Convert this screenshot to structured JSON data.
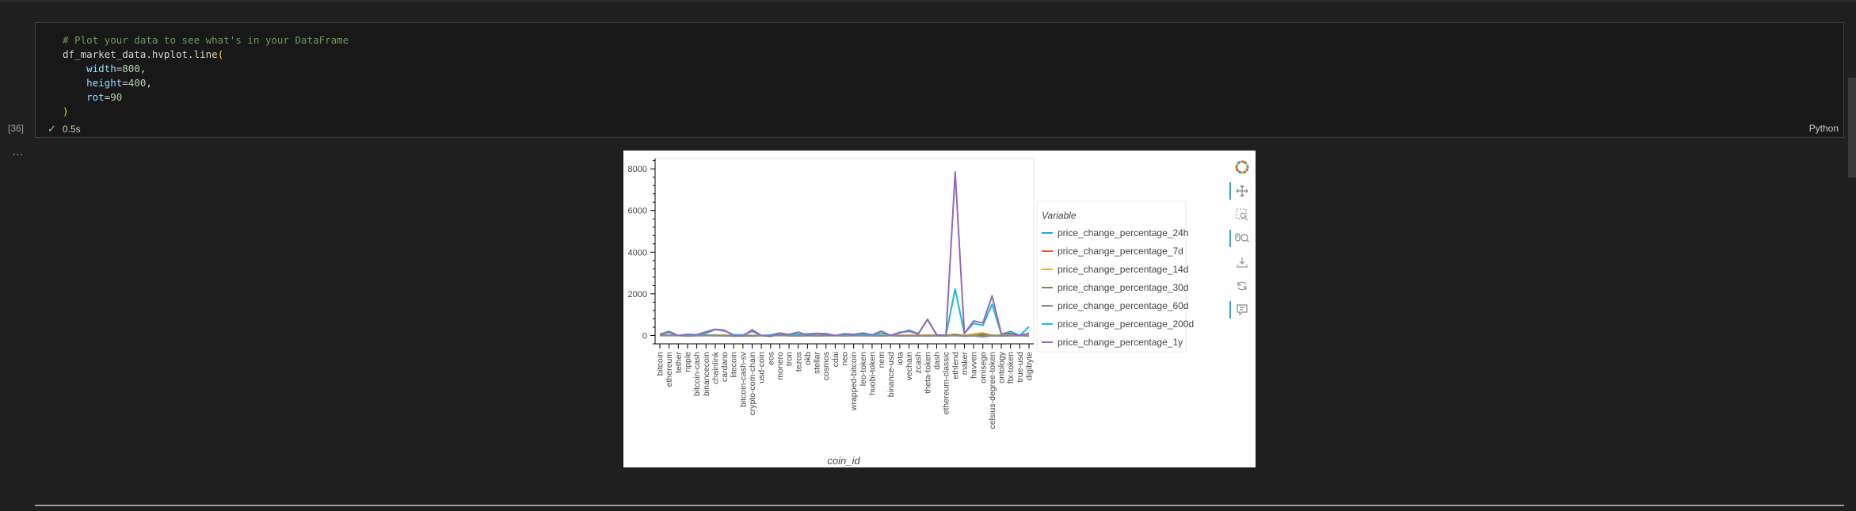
{
  "cell": {
    "code_lines": [
      "# Plot your data to see what's in your DataFrame",
      "df_market_data.hvplot.line(",
      "    width=800,",
      "    height=400,",
      "    rot=90",
      ")"
    ],
    "execution_count": "[36]",
    "exec_time": "0.5s",
    "language": "Python",
    "output_more": "..."
  },
  "toolbar": {
    "tools": [
      {
        "icon": "bokeh-logo-icon",
        "active": false
      },
      {
        "icon": "pan-icon",
        "active": true
      },
      {
        "icon": "box-zoom-icon",
        "active": false
      },
      {
        "icon": "wheel-zoom-icon",
        "active": true
      },
      {
        "icon": "save-icon",
        "active": false
      },
      {
        "icon": "reset-icon",
        "active": false
      },
      {
        "icon": "hover-icon",
        "active": true
      }
    ]
  },
  "chart_data": {
    "type": "line",
    "title": "",
    "xlabel": "coin_id",
    "ylabel": "",
    "ylim": [
      -400,
      8500
    ],
    "yticks": [
      0,
      2000,
      4000,
      6000,
      8000
    ],
    "legend_title": "Variable",
    "legend_position": "right",
    "grid": false,
    "x_tick_rotation": 90,
    "categories": [
      "bitcoin",
      "ethereum",
      "tether",
      "ripple",
      "bitcoin-cash",
      "binancecoin",
      "chainlink",
      "cardano",
      "litecoin",
      "bitcoin-cash-sv",
      "crypto-com-chain",
      "usd-coin",
      "eos",
      "monero",
      "tron",
      "tezos",
      "okb",
      "stellar",
      "cosmos",
      "cdai",
      "neo",
      "wrapped-bitcoin",
      "leo-token",
      "huobi-token",
      "nem",
      "binance-usd",
      "iota",
      "vechain",
      "zcash",
      "theta-token",
      "dash",
      "ethereum-classic",
      "ethlend",
      "maker",
      "havven",
      "omisego",
      "celsius-degree-token",
      "ontology",
      "ftx-token",
      "true-usd",
      "digibyte"
    ],
    "series": [
      {
        "name": "price_change_percentage_24h",
        "color": "#30a2da",
        "values": [
          1,
          0,
          0,
          0,
          1,
          2,
          1,
          0,
          0,
          1,
          0,
          0,
          0,
          1,
          0,
          0,
          1,
          0,
          1,
          0,
          0,
          1,
          0,
          0,
          1,
          0,
          0,
          0,
          1,
          0,
          0,
          0,
          1,
          0,
          2,
          1,
          0,
          1,
          0,
          0,
          1
        ]
      },
      {
        "name": "price_change_percentage_7d",
        "color": "#fc4f30",
        "values": [
          8,
          13,
          1,
          9,
          12,
          13,
          22,
          15,
          6,
          15,
          8,
          0,
          5,
          13,
          9,
          11,
          18,
          10,
          9,
          0,
          7,
          8,
          3,
          3,
          12,
          0,
          8,
          11,
          10,
          17,
          6,
          18,
          40,
          9,
          52,
          26,
          12,
          21,
          14,
          0,
          32
        ]
      },
      {
        "name": "price_change_percentage_14d",
        "color": "#e5ae38",
        "values": [
          7,
          9,
          0,
          0,
          5,
          6,
          19,
          10,
          9,
          1,
          12,
          0,
          7,
          5,
          7,
          16,
          1,
          11,
          5,
          0,
          9,
          7,
          0,
          1,
          6,
          0,
          12,
          10,
          8,
          16,
          5,
          8,
          60,
          14,
          70,
          120,
          12,
          30,
          10,
          0,
          30
        ]
      },
      {
        "name": "price_change_percentage_30d",
        "color": "#6d904f",
        "values": [
          0,
          4,
          0,
          -18,
          1,
          -4,
          -13,
          -10,
          -22,
          -20,
          -29,
          0,
          -17,
          2,
          -8,
          -18,
          -7,
          -13,
          -3,
          0,
          -16,
          -2,
          -9,
          -8,
          -18,
          0,
          -24,
          -16,
          -11,
          -31,
          -12,
          -18,
          32,
          -25,
          -20,
          80,
          -15,
          -13,
          -11,
          0,
          -22
        ]
      },
      {
        "name": "price_change_percentage_60d",
        "color": "#8b8b8b",
        "values": [
          -5,
          -4,
          0,
          -28,
          -6,
          0,
          14,
          -14,
          -30,
          -15,
          -19,
          0,
          -21,
          28,
          -14,
          -10,
          -2,
          -21,
          -10,
          0,
          -16,
          -5,
          -6,
          -4,
          -20,
          0,
          -16,
          -5,
          -25,
          0,
          -15,
          -18,
          -5,
          -32,
          -11,
          -60,
          -5,
          -30,
          -10,
          0,
          -20
        ]
      },
      {
        "name": "price_change_percentage_200d",
        "color": "#17becf",
        "values": [
          49,
          140,
          0,
          27,
          24,
          101,
          285,
          220,
          36,
          27,
          196,
          -1,
          22,
          120,
          40,
          59,
          79,
          98,
          91,
          -1,
          48,
          46,
          54,
          4,
          110,
          -1,
          120,
          257,
          88,
          772,
          22,
          15,
          2227,
          102,
          580,
          480,
          1500,
          58,
          200,
          -1,
          423
        ]
      },
      {
        "name": "price_change_percentage_1y",
        "color": "#9467bd",
        "values": [
          55,
          198,
          -1,
          55,
          34,
          180,
          300,
          250,
          -12,
          -25,
          276,
          0,
          -44,
          108,
          52,
          163,
          10,
          97,
          50,
          -1,
          82,
          51,
          117,
          29,
          213,
          -1,
          150,
          200,
          70,
          780,
          30,
          -5,
          7853,
          90,
          700,
          600,
          1900,
          80,
          100,
          0,
          110
        ]
      }
    ]
  }
}
